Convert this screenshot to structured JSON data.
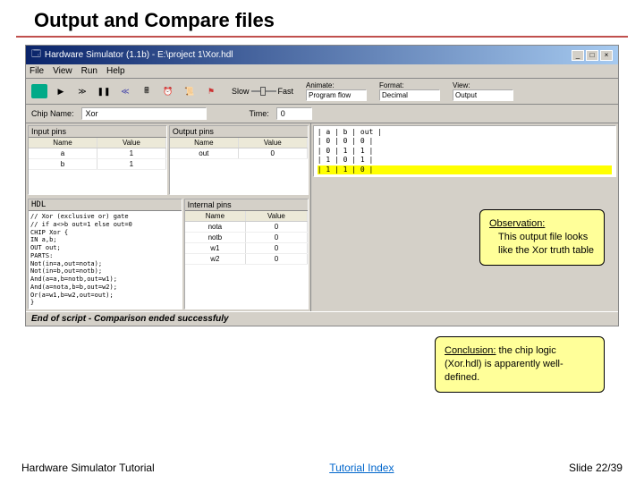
{
  "slide": {
    "title": "Output and Compare files"
  },
  "window": {
    "title": "Hardware Simulator (1.1b) - E:\\project 1\\Xor.hdl",
    "menu": [
      "File",
      "View",
      "Run",
      "Help"
    ]
  },
  "toolbar": {
    "slow": "Slow",
    "fast": "Fast",
    "animate_label": "Animate:",
    "animate_value": "Program flow",
    "format_label": "Format:",
    "format_value": "Decimal",
    "view_label": "View:",
    "view_value": "Output"
  },
  "topbar": {
    "chip_label": "Chip Name:",
    "chip_value": "Xor",
    "time_label": "Time:",
    "time_value": "0"
  },
  "inputs": {
    "title": "Input pins",
    "header_name": "Name",
    "header_value": "Value",
    "rows": [
      {
        "name": "a",
        "value": "1"
      },
      {
        "name": "b",
        "value": "1"
      }
    ]
  },
  "outputs": {
    "title": "Output pins",
    "header_name": "Name",
    "header_value": "Value",
    "rows": [
      {
        "name": "out",
        "value": "0"
      }
    ]
  },
  "hdl": {
    "title": "HDL",
    "lines": [
      "// Xor (exclusive or) gate",
      "// if a<>b out=1 else out=0",
      "CHIP Xor {",
      " IN a,b;",
      " OUT out;",
      " PARTS:",
      " Not(in=a,out=nota);",
      " Not(in=b,out=notb);",
      " And(a=a,b=notb,out=w1);",
      " And(a=nota,b=b,out=w2);",
      " Or(a=w1,b=w2,out=out);",
      "}"
    ]
  },
  "internal": {
    "title": "Internal pins",
    "header_name": "Name",
    "header_value": "Value",
    "rows": [
      {
        "name": "nota",
        "value": "0"
      },
      {
        "name": "notb",
        "value": "0"
      },
      {
        "name": "w1",
        "value": "0"
      },
      {
        "name": "w2",
        "value": "0"
      }
    ]
  },
  "output_area": {
    "lines": [
      "|  a  |  b  | out |",
      "|  0  |  0  |  0  |",
      "|  0  |  1  |  1  |",
      "|  1  |  0  |  1  |",
      "|  1  |  1  |  0  |"
    ]
  },
  "status": "End of script - Comparison ended successfuly",
  "observation": {
    "label": "Observation:",
    "body": "This output file looks like the Xor truth table"
  },
  "conclusion": {
    "label": "Conclusion:",
    "body": " the chip logic (Xor.hdl) is apparently well-defined."
  },
  "footer": {
    "left": "Hardware Simulator Tutorial",
    "center": "Tutorial Index",
    "right": "Slide 22/39"
  }
}
